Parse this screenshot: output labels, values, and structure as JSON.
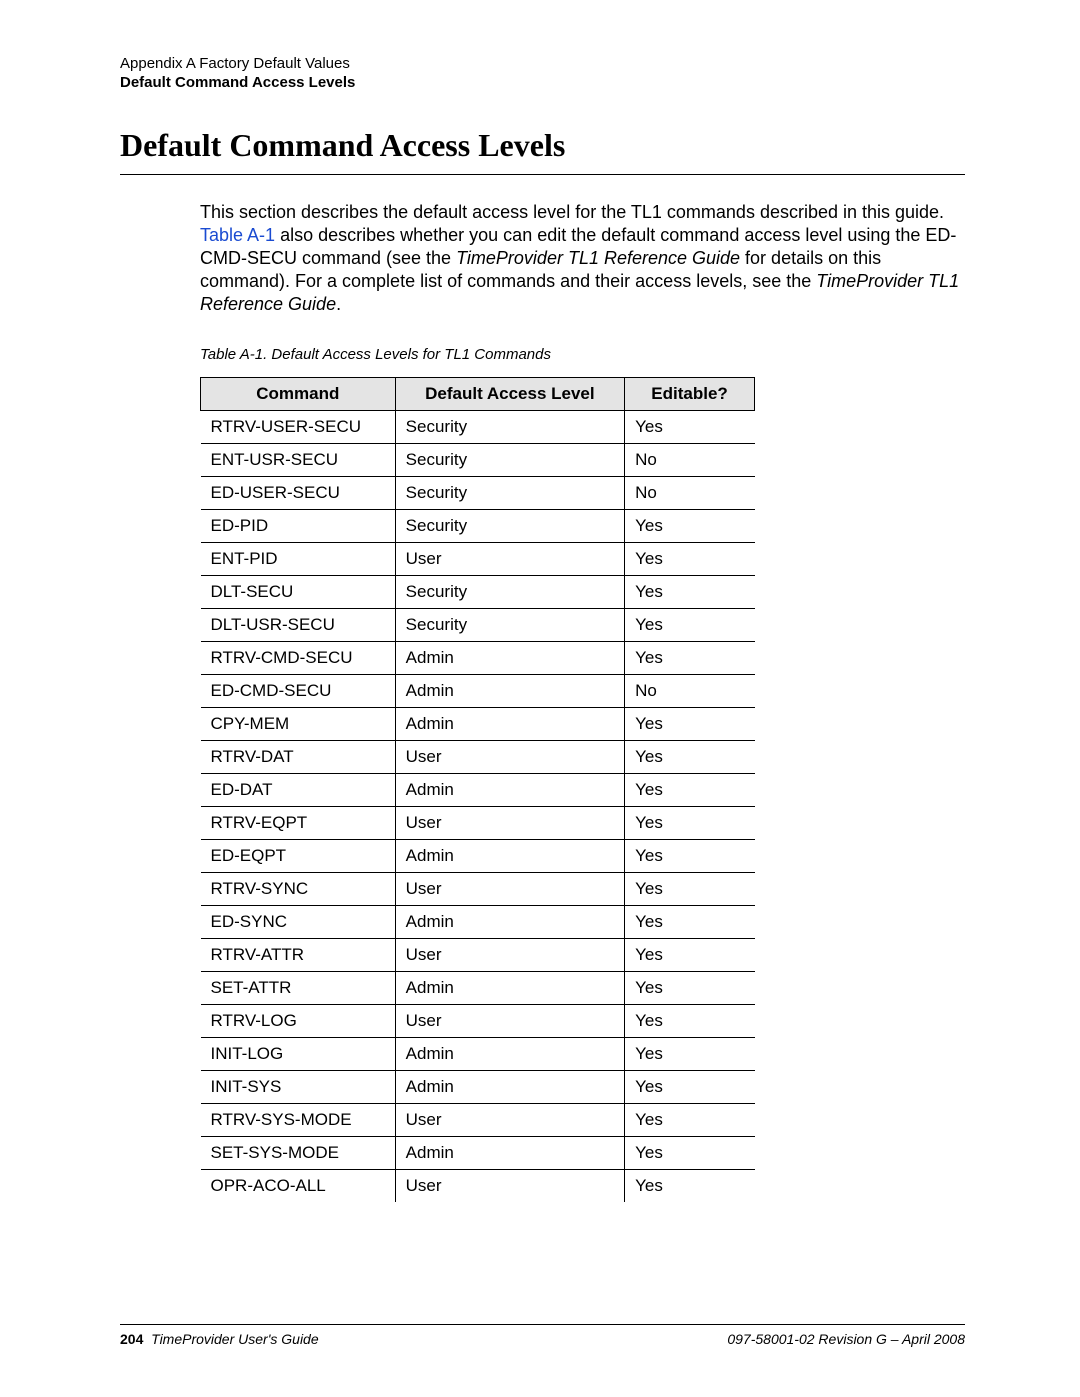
{
  "header": {
    "line1": "Appendix A Factory Default Values",
    "line2": "Default Command Access Levels"
  },
  "heading": "Default Command Access Levels",
  "body": {
    "p1_a": "This section describes the default access level for the TL1 commands described in this guide. ",
    "p1_link": "Table A-1",
    "p1_b": " also describes whether you can edit the default command access level using the ED-CMD-SECU command (see the ",
    "p1_ital1": "TimeProvider TL1 Reference Guide",
    "p1_c": " for details on this command). For a complete list of commands and their access levels, see the ",
    "p1_ital2": "TimeProvider TL1 Reference Guide",
    "p1_d": "."
  },
  "table": {
    "caption": "Table A-1.  Default Access Levels for TL1 Commands",
    "headers": {
      "c1": "Command",
      "c2": "Default Access Level",
      "c3": "Editable?"
    },
    "rows": [
      {
        "cmd": "RTRV-USER-SECU",
        "level": "Security",
        "editable": "Yes"
      },
      {
        "cmd": "ENT-USR-SECU",
        "level": "Security",
        "editable": "No"
      },
      {
        "cmd": "ED-USER-SECU",
        "level": "Security",
        "editable": "No"
      },
      {
        "cmd": "ED-PID",
        "level": "Security",
        "editable": "Yes"
      },
      {
        "cmd": "ENT-PID",
        "level": "User",
        "editable": "Yes"
      },
      {
        "cmd": "DLT-SECU",
        "level": "Security",
        "editable": "Yes"
      },
      {
        "cmd": "DLT-USR-SECU",
        "level": "Security",
        "editable": "Yes"
      },
      {
        "cmd": "RTRV-CMD-SECU",
        "level": "Admin",
        "editable": "Yes"
      },
      {
        "cmd": "ED-CMD-SECU",
        "level": "Admin",
        "editable": "No"
      },
      {
        "cmd": "CPY-MEM",
        "level": "Admin",
        "editable": "Yes"
      },
      {
        "cmd": "RTRV-DAT",
        "level": "User",
        "editable": "Yes"
      },
      {
        "cmd": "ED-DAT",
        "level": "Admin",
        "editable": "Yes"
      },
      {
        "cmd": "RTRV-EQPT",
        "level": "User",
        "editable": "Yes"
      },
      {
        "cmd": "ED-EQPT",
        "level": "Admin",
        "editable": "Yes"
      },
      {
        "cmd": "RTRV-SYNC",
        "level": "User",
        "editable": "Yes"
      },
      {
        "cmd": "ED-SYNC",
        "level": "Admin",
        "editable": "Yes"
      },
      {
        "cmd": "RTRV-ATTR",
        "level": "User",
        "editable": "Yes"
      },
      {
        "cmd": "SET-ATTR",
        "level": "Admin",
        "editable": "Yes"
      },
      {
        "cmd": "RTRV-LOG",
        "level": "User",
        "editable": "Yes"
      },
      {
        "cmd": "INIT-LOG",
        "level": "Admin",
        "editable": "Yes"
      },
      {
        "cmd": "INIT-SYS",
        "level": "Admin",
        "editable": "Yes"
      },
      {
        "cmd": "RTRV-SYS-MODE",
        "level": "User",
        "editable": "Yes"
      },
      {
        "cmd": "SET-SYS-MODE",
        "level": "Admin",
        "editable": "Yes"
      },
      {
        "cmd": "OPR-ACO-ALL",
        "level": "User",
        "editable": "Yes"
      }
    ]
  },
  "footer": {
    "page": "204",
    "left": "TimeProvider User's Guide",
    "right": "097-58001-02 Revision G – April 2008"
  }
}
